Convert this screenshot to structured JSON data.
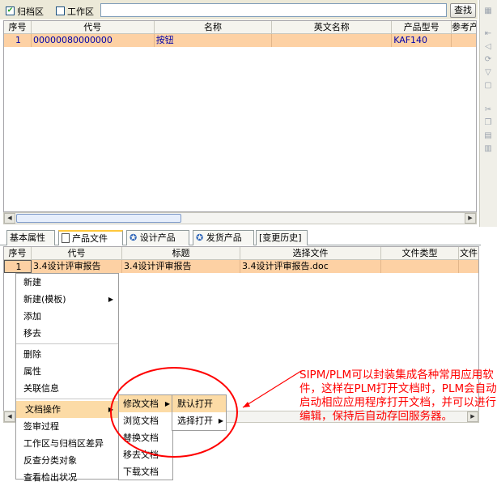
{
  "toolbar": {
    "archive_label": "归档区",
    "work_label": "工作区",
    "search_value": "",
    "search_button": "查找"
  },
  "main_table": {
    "headers": [
      "序号",
      "代号",
      "名称",
      "英文名称",
      "产品型号",
      "参考产"
    ],
    "rows": [
      {
        "seq": "1",
        "code": "00000080000000",
        "name": "按钮",
        "en_name": "",
        "model": "KAF140",
        "ref": ""
      }
    ]
  },
  "tabs": [
    {
      "label": "基本属性"
    },
    {
      "label": "产品文件"
    },
    {
      "label": "设计产品"
    },
    {
      "label": "发货产品"
    },
    {
      "label": "[变更历史]"
    }
  ],
  "doc_table": {
    "headers": [
      "序号",
      "代号",
      "标题",
      "选择文件",
      "文件类型",
      "文件"
    ],
    "rows": [
      {
        "seq": "1",
        "code": "3.4设计评审报告",
        "title": "3.4设计评审报告",
        "file": "3.4设计评审报告.doc",
        "type": "",
        "more": ""
      }
    ]
  },
  "context_menu": {
    "items": [
      "新建",
      "新建(模板)",
      "添加",
      "移去",
      "删除",
      "属性",
      "关联信息",
      "文档操作",
      "签审过程",
      "工作区与归档区差异",
      "反查分类对象",
      "查看检出状况"
    ]
  },
  "doc_ops_menu": {
    "items": [
      "修改文档",
      "浏览文档",
      "替换文档",
      "移去文档",
      "下载文档"
    ]
  },
  "open_menu": {
    "items": [
      "默认打开",
      "选择打开"
    ]
  },
  "annotation": {
    "text": "SIPM/PLM可以封装集成各种常用应用软件，这样在PLM打开文档时，PLM会自动启动相应应用程序打开文档，并可以进行编辑，保持后自动存回服务器。"
  },
  "colors": {
    "selected_row": "#fdd1a4",
    "menu_highlight": "#fcdba6",
    "annotation": "#ff0000",
    "tab_accent": "#ffc83c"
  }
}
